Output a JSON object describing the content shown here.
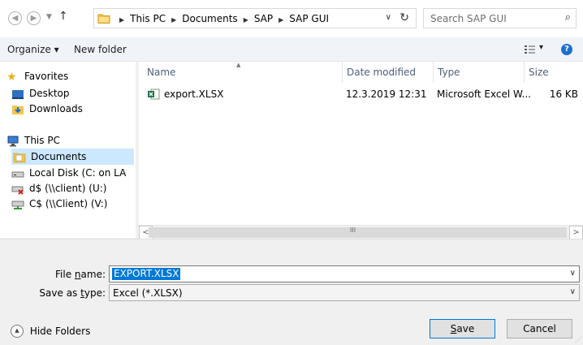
{
  "address": {
    "crumbs": [
      "This PC",
      "Documents",
      "SAP",
      "SAP GUI"
    ],
    "dropdown_icon": "chevron-down-icon",
    "refresh_icon": "refresh-icon"
  },
  "search": {
    "placeholder": "Search SAP GUI",
    "icon": "search-icon"
  },
  "toolbar": {
    "organize_label": "Organize ▾",
    "new_folder_label": "New folder",
    "view_icon": "view-options-icon",
    "view_arrow": "▾",
    "help_icon": "help-icon"
  },
  "navpane": {
    "favorites_label": "Favorites",
    "desktop_label": "Desktop",
    "downloads_label": "Downloads",
    "thispc_label": "This PC",
    "documents_label": "Documents",
    "localdisk_label": "Local Disk (C: on LA",
    "d_share_label": "d$ (\\\\client) (U:)",
    "c_share_label": "C$ (\\\\Client) (V:)"
  },
  "filelist": {
    "columns": {
      "name": "Name",
      "date": "Date modified",
      "type": "Type",
      "size": "Size"
    },
    "rows": [
      {
        "name": "export.XLSX",
        "date": "12.3.2019 12:31",
        "type": "Microsoft Excel W...",
        "size": "16 KB"
      }
    ]
  },
  "scrollbar": {
    "left_arrow": "<",
    "right_arrow": ">",
    "thumb_grip": "III"
  },
  "form": {
    "filename_label_pre": "File ",
    "filename_label_u": "n",
    "filename_label_post": "ame:",
    "filename_value": "EXPORT.XLSX",
    "savetype_label_pre": "Save as ",
    "savetype_label_u": "t",
    "savetype_label_post": "ype:",
    "savetype_value": "Excel (*.XLSX)"
  },
  "buttons": {
    "hide_folders": "Hide Folders",
    "save_u": "S",
    "save_rest": "ave",
    "cancel": "Cancel"
  },
  "colors": {
    "selection": "#0078d7",
    "nav_selected": "#cce8ff",
    "toolbar": "#f0f4f9"
  }
}
